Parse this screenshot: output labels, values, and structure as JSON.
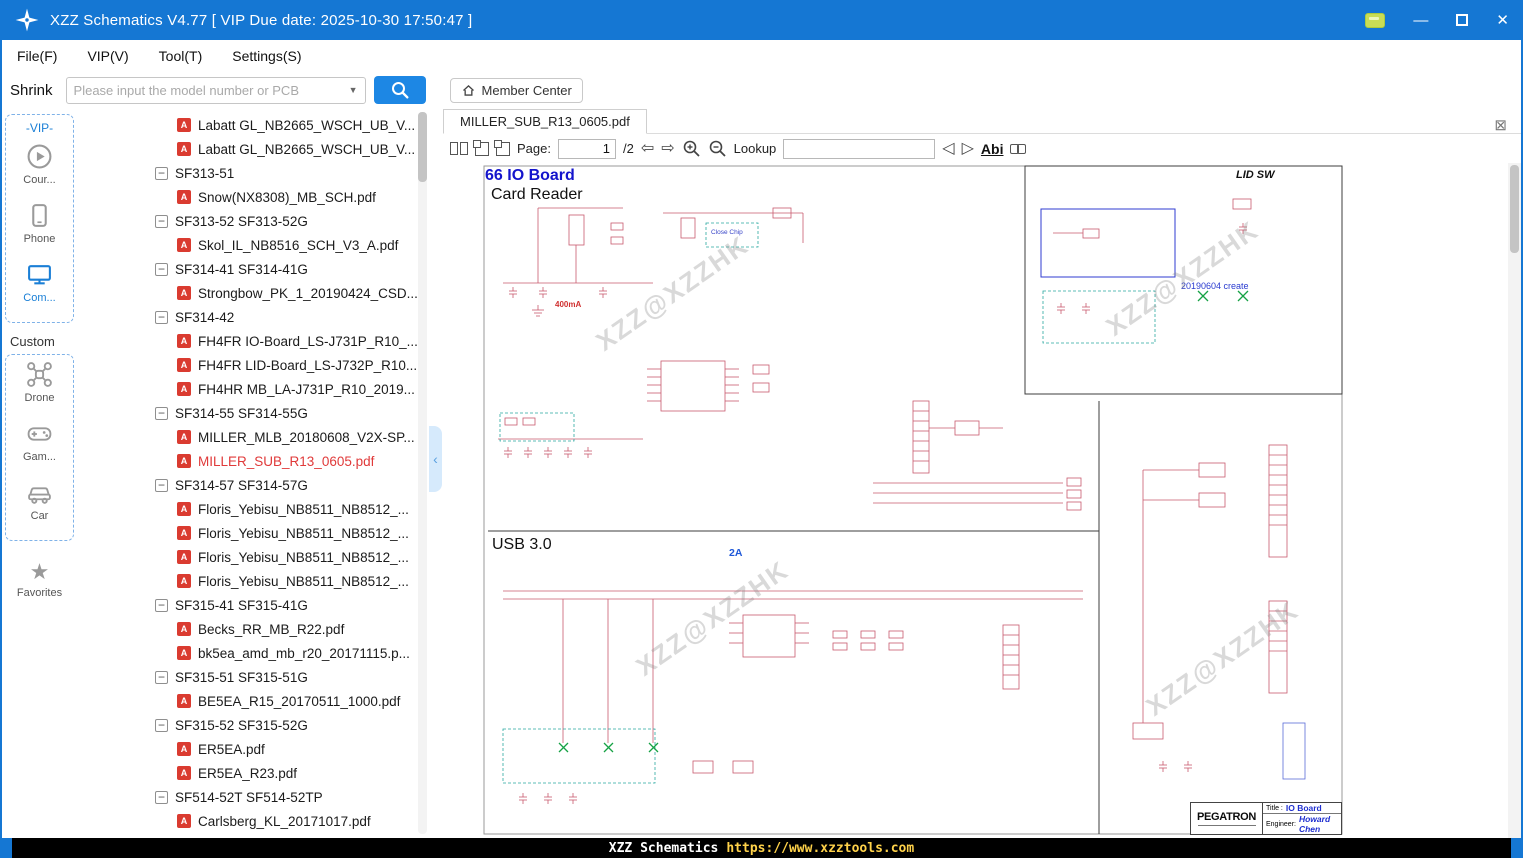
{
  "titlebar": {
    "title": "XZZ Schematics V4.77 [ VIP Due date: 2025-10-30 17:50:47 ]"
  },
  "menu": {
    "items": [
      "File(F)",
      "VIP(V)",
      "Tool(T)",
      "Settings(S)"
    ]
  },
  "search": {
    "shrink_label": "Shrink",
    "placeholder": "Please input the model number or PCB",
    "member_center_label": "Member Center"
  },
  "sidebar": {
    "vip_label": "-VIP-",
    "custom_label": "Custom",
    "vip_items": [
      {
        "icon": "play-icon",
        "label": "Cour..."
      },
      {
        "icon": "phone-icon",
        "label": "Phone"
      },
      {
        "icon": "computer-icon",
        "label": "Com..."
      }
    ],
    "custom_items": [
      {
        "icon": "drone-icon",
        "label": "Drone"
      },
      {
        "icon": "gamepad-icon",
        "label": "Gam..."
      },
      {
        "icon": "car-icon",
        "label": "Car"
      }
    ],
    "favorites_label": "Favorites"
  },
  "tree": {
    "items": [
      {
        "kind": "pdf",
        "label": "Labatt GL_NB2665_WSCH_UB_V..."
      },
      {
        "kind": "pdf",
        "label": "Labatt GL_NB2665_WSCH_UB_V..."
      },
      {
        "kind": "folder",
        "label": "SF313-51"
      },
      {
        "kind": "pdf",
        "label": "Snow(NX8308)_MB_SCH.pdf"
      },
      {
        "kind": "folder",
        "label": "SF313-52 SF313-52G"
      },
      {
        "kind": "pdf",
        "label": "Skol_IL_NB8516_SCH_V3_A.pdf"
      },
      {
        "kind": "folder",
        "label": "SF314-41 SF314-41G"
      },
      {
        "kind": "pdf",
        "label": "Strongbow_PK_1_20190424_CSD..."
      },
      {
        "kind": "folder",
        "label": "SF314-42"
      },
      {
        "kind": "pdf",
        "label": "FH4FR IO-Board_LS-J731P_R10_..."
      },
      {
        "kind": "pdf",
        "label": "FH4FR LID-Board_LS-J732P_R10..."
      },
      {
        "kind": "pdf",
        "label": "FH4HR MB_LA-J731P_R10_2019..."
      },
      {
        "kind": "folder",
        "label": "SF314-55 SF314-55G"
      },
      {
        "kind": "pdf",
        "label": "MILLER_MLB_20180608_V2X-SP..."
      },
      {
        "kind": "pdf",
        "label": "MILLER_SUB_R13_0605.pdf",
        "selected": true
      },
      {
        "kind": "folder",
        "label": "SF314-57 SF314-57G"
      },
      {
        "kind": "pdf",
        "label": "Floris_Yebisu_NB8511_NB8512_..."
      },
      {
        "kind": "pdf",
        "label": "Floris_Yebisu_NB8511_NB8512_..."
      },
      {
        "kind": "pdf",
        "label": "Floris_Yebisu_NB8511_NB8512_..."
      },
      {
        "kind": "pdf",
        "label": "Floris_Yebisu_NB8511_NB8512_..."
      },
      {
        "kind": "folder",
        "label": "SF315-41 SF315-41G"
      },
      {
        "kind": "pdf",
        "label": "Becks_RR_MB_R22.pdf"
      },
      {
        "kind": "pdf",
        "label": "bk5ea_amd_mb_r20_20171115.p..."
      },
      {
        "kind": "folder",
        "label": "SF315-51 SF315-51G"
      },
      {
        "kind": "pdf",
        "label": "BE5EA_R15_20170511_1000.pdf"
      },
      {
        "kind": "folder",
        "label": "SF315-52 SF315-52G"
      },
      {
        "kind": "pdf",
        "label": "ER5EA.pdf"
      },
      {
        "kind": "pdf",
        "label": "ER5EA_R23.pdf"
      },
      {
        "kind": "folder",
        "label": "SF514-52T SF514-52TP"
      },
      {
        "kind": "pdf",
        "label": "Carlsberg_KL_20171017.pdf"
      }
    ]
  },
  "viewer": {
    "tab_title": "MILLER_SUB_R13_0605.pdf",
    "toolbar": {
      "page_label": "Page:",
      "page_value": "1",
      "page_total": "/2",
      "lookup_label": "Lookup",
      "abi_label": "Abi"
    }
  },
  "icons": {
    "chevron_down": "▼",
    "prev_page": "⇦",
    "next_page": "⇨",
    "prev_result": "◁",
    "next_result": "▷",
    "close_document": "⊠",
    "minimize": "—",
    "close": "✕",
    "collapse": "−",
    "pdf_glyph": "A",
    "star": "★",
    "collapse_tree": "‹"
  },
  "schematic": {
    "section_title": "66 IO Board",
    "section_subtitle": "Card Reader",
    "usb_title": "USB 3.0",
    "lid_sw_title": "LID SW",
    "close_chip_note": "Close Chip",
    "current_limit_1": "400mA",
    "current_limit_2": "2A",
    "create_note": "20190604 create",
    "watermark": "XZZ@XZZHK",
    "titleblock": {
      "brand": "PEGATRON",
      "title_label": "Title :",
      "title_value": "IO Board",
      "engineer_label": "Engineer:",
      "engineer_value": "Howard Chen"
    }
  },
  "statusbar": {
    "app": "XZZ Schematics",
    "url": "https://www.xzztools.com"
  },
  "colors": {
    "accent_blue": "#1577d3",
    "selected_red": "#e03a3a",
    "schematic_pink": "#c85a6e",
    "schematic_blue": "#2f3bd2",
    "schematic_green": "#17a245"
  }
}
